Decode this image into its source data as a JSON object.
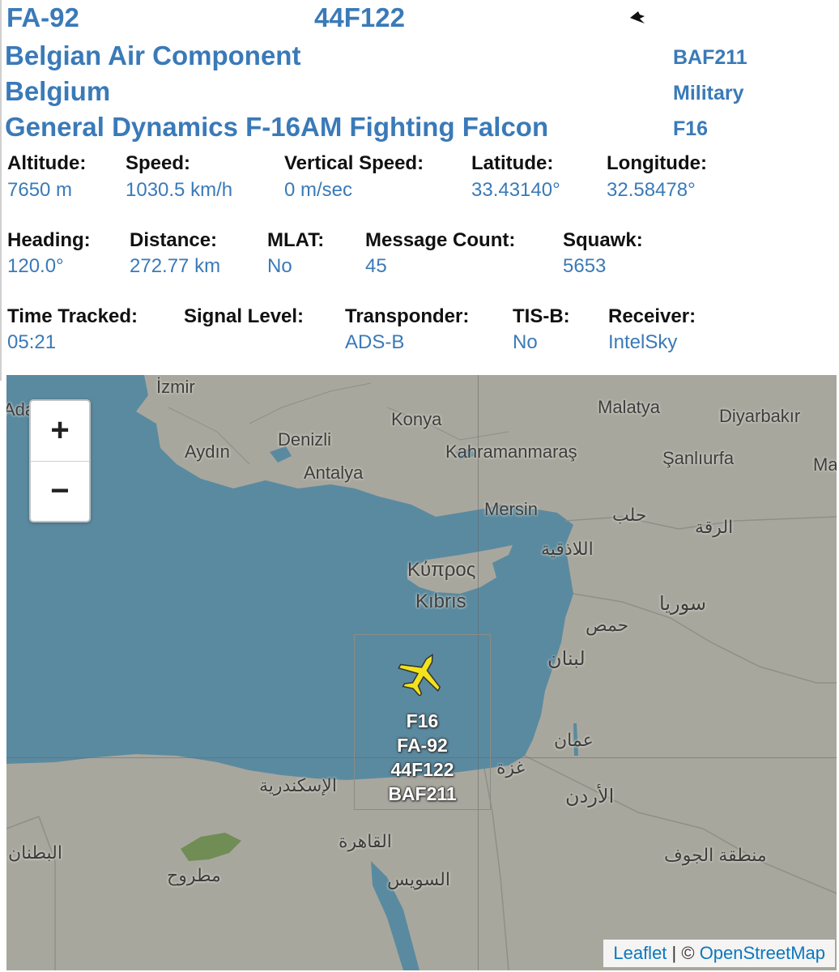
{
  "header": {
    "registration": "FA-92",
    "hex_code": "44F122",
    "operator": "Belgian Air Component",
    "callsign": "BAF211",
    "country": "Belgium",
    "category": "Military",
    "aircraft_model": "General Dynamics F-16AM Fighting Falcon",
    "type_code": "F16",
    "flag_icon": "flag-icon"
  },
  "stats": {
    "altitude": {
      "label": "Altitude:",
      "value": "7650 m"
    },
    "speed": {
      "label": "Speed:",
      "value": "1030.5 km/h"
    },
    "vertical_speed": {
      "label": "Vertical Speed:",
      "value": "0 m/sec"
    },
    "latitude": {
      "label": "Latitude:",
      "value": "33.43140°"
    },
    "longitude": {
      "label": "Longitude:",
      "value": "32.58478°"
    },
    "heading": {
      "label": "Heading:",
      "value": "120.0°"
    },
    "distance": {
      "label": "Distance:",
      "value": "272.77 km"
    },
    "mlat": {
      "label": "MLAT:",
      "value": "No"
    },
    "message_count": {
      "label": "Message Count:",
      "value": "45"
    },
    "squawk": {
      "label": "Squawk:",
      "value": "5653"
    },
    "time_tracked": {
      "label": "Time Tracked:",
      "value": "05:21"
    },
    "signal_level": {
      "label": "Signal Level:",
      "value": ""
    },
    "transponder": {
      "label": "Transponder:",
      "value": "ADS-B"
    },
    "tis_b": {
      "label": "TIS-B:",
      "value": "No"
    },
    "receiver": {
      "label": "Receiver:",
      "value": "IntelSky"
    }
  },
  "map": {
    "zoom_in": "+",
    "zoom_out": "−",
    "places": {
      "izmir": "İzmir",
      "konya": "Konya",
      "malatya": "Malatya",
      "diyarbakir": "Diyarbakır",
      "aydin": "Aydın",
      "denizli": "Denizli",
      "kahramanmaras": "Kahramanmaraş",
      "sanliurfa": "Şanlıurfa",
      "mardin": "Ma",
      "antalya": "Antalya",
      "mersin": "Mersin",
      "aleppo": "حلب",
      "raqqa": "الرقة",
      "latakia": "اللاذقية",
      "cyprus_gr": "Κύπρος",
      "cyprus_tr": "Kıbrıs",
      "syria": "سوريا",
      "homs": "حمص",
      "lebanon": "لبنان",
      "amman": "عمان",
      "gaza": "غزة",
      "alexandria": "الإسكندرية",
      "jordan": "الأردن",
      "cairo": "القاهرة",
      "suez": "السويس",
      "jawf": "منطقة الجوف",
      "matrouh": "مطروح",
      "butnan": "البطنان",
      "ada": "Ada"
    },
    "aircraft_label": [
      "F16",
      "FA-92",
      "44F122",
      "BAF211"
    ],
    "attribution": {
      "leaflet": "Leaflet",
      "separator": " | © ",
      "osm": "OpenStreetMap"
    },
    "colors": {
      "sea": "#5a8aa0",
      "land": "#a8a79e",
      "plane": "#f2e21c",
      "link": "#3a7ab8"
    }
  }
}
